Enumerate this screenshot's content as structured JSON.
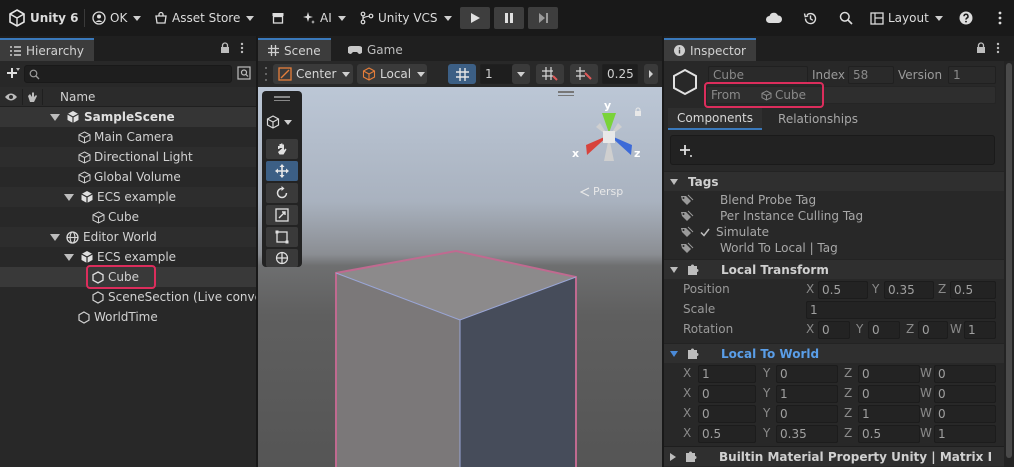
{
  "toolbar": {
    "product": "Unity 6",
    "account": "OK",
    "asset_store": "Asset Store",
    "ai": "AI",
    "vcs": "Unity VCS",
    "layout": "Layout"
  },
  "hierarchy": {
    "tab_label": "Hierarchy",
    "column_name": "Name",
    "items": [
      {
        "label": "SampleScene"
      },
      {
        "label": "Main Camera"
      },
      {
        "label": "Directional Light"
      },
      {
        "label": "Global Volume"
      },
      {
        "label": "ECS example"
      },
      {
        "label": "Cube"
      },
      {
        "label": "Editor World"
      },
      {
        "label": "ECS example"
      },
      {
        "label": "Cube"
      },
      {
        "label": "SceneSection (Live conversion)"
      },
      {
        "label": "WorldTime"
      }
    ]
  },
  "scene": {
    "tab_label": "Scene",
    "game_tab_label": "Game",
    "pivot_mode": "Center",
    "pivot_space": "Local",
    "grid_size": "1",
    "snap_value": "0.25",
    "gizmo": {
      "y": "y",
      "x": "x",
      "z": "z",
      "projection": "Persp"
    }
  },
  "inspector": {
    "tab_label": "Inspector",
    "entity_name": "Cube",
    "index_label": "Index",
    "index_value": "58",
    "version_label": "Version",
    "version_value": "1",
    "from_label": "From",
    "from_value": "Cube",
    "tabs": {
      "components": "Components",
      "relationships": "Relationships"
    },
    "tags_title": "Tags",
    "tags": [
      {
        "label": "Blend Probe Tag"
      },
      {
        "label": "Per Instance Culling Tag"
      },
      {
        "label": "Simulate"
      },
      {
        "label": "World To Local | Tag"
      }
    ],
    "local_transform": {
      "title": "Local Transform",
      "position_label": "Position",
      "position": {
        "x": "0.5",
        "y": "0.35",
        "z": "0.5"
      },
      "scale_label": "Scale",
      "scale": "1",
      "rotation_label": "Rotation",
      "rotation": {
        "x": "0",
        "y": "0",
        "z": "0",
        "w": "1"
      }
    },
    "local_to_world": {
      "title": "Local To World",
      "rows": [
        {
          "x": "1",
          "y": "0",
          "z": "0",
          "w": "0"
        },
        {
          "x": "0",
          "y": "1",
          "z": "0",
          "w": "0"
        },
        {
          "x": "0",
          "y": "0",
          "z": "1",
          "w": "0"
        },
        {
          "x": "0.5",
          "y": "0.35",
          "z": "0.5",
          "w": "1"
        }
      ]
    },
    "builtin_material": {
      "title": "Builtin Material Property Unity | Matrix Previous"
    }
  }
}
